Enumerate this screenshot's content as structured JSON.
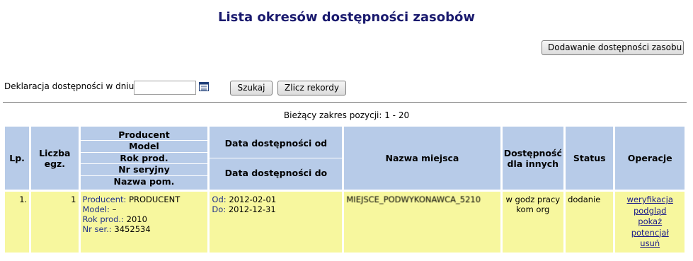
{
  "page": {
    "title": "Lista okresów dostępności zasobów",
    "add_button": "Dodawanie dostępności zasobu"
  },
  "filter": {
    "label": "Deklaracja dostępności w dniu:",
    "date_value": "",
    "calendar_icon": "calendar-icon",
    "search_button": "Szukaj",
    "count_button": "Zlicz rekordy"
  },
  "range_info": "Bieżący zakres pozycji: 1 - 20",
  "table": {
    "headers": {
      "lp": "Lp.",
      "count": "Liczba egz.",
      "producer": "Producent",
      "model": "Model",
      "year": "Rok prod.",
      "serial": "Nr seryjny",
      "room": "Nazwa pom.",
      "date_from": "Data dostępności od",
      "date_to": "Data dostępności do",
      "place": "Nazwa miejsca",
      "availability": "Dostępność dla innych",
      "status": "Status",
      "operations": "Operacje"
    },
    "rows": [
      {
        "lp": "1.",
        "count": "1",
        "producer_label": "Producent:",
        "producer": "PRODUCENT",
        "model_label": "Model:",
        "model": "–",
        "year_label": "Rok prod.:",
        "year": "2010",
        "serial_label": "Nr ser.:",
        "serial": "3452534",
        "from_label": "Od:",
        "from": "2012-02-01",
        "to_label": "Do:",
        "to": "2012-12-31",
        "place": "MIEJSCE_PODWYKONAWCA_5210",
        "availability": "w godz pracy kom org",
        "status": "dodanie",
        "ops": [
          "weryfikacja",
          "podgląd",
          "pokaż",
          "potencjał",
          "usuń"
        ]
      }
    ]
  }
}
